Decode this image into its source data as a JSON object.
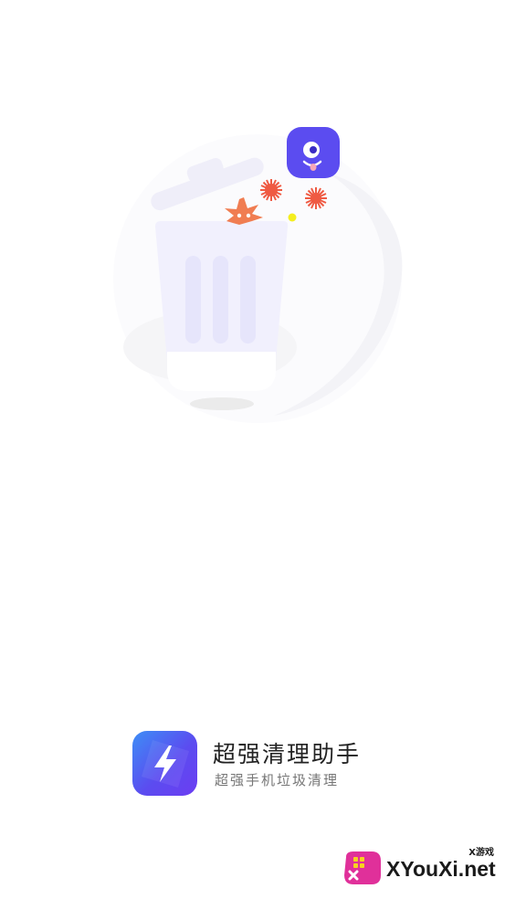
{
  "app": {
    "name": "超强清理助手",
    "slogan": "超强手机垃圾清理"
  },
  "illustration": {
    "main_icon": "trash-can-icon",
    "mascot_icon": "one-eyed-monster-icon",
    "germ_icons": [
      "virus-icon",
      "germ-icon",
      "germ-icon"
    ]
  },
  "watermark": {
    "main_text": "XYouXi.net",
    "small_text": "X游戏",
    "icon": "gamepad-icon"
  },
  "colors": {
    "brand_purple": "#5b4cf0",
    "brand_blue": "#3d8ef6",
    "germ_red": "#ef5a43",
    "germ_orange": "#f07d52",
    "dot_yellow": "#f4ee1f",
    "trash_light": "#f1f0fd"
  }
}
